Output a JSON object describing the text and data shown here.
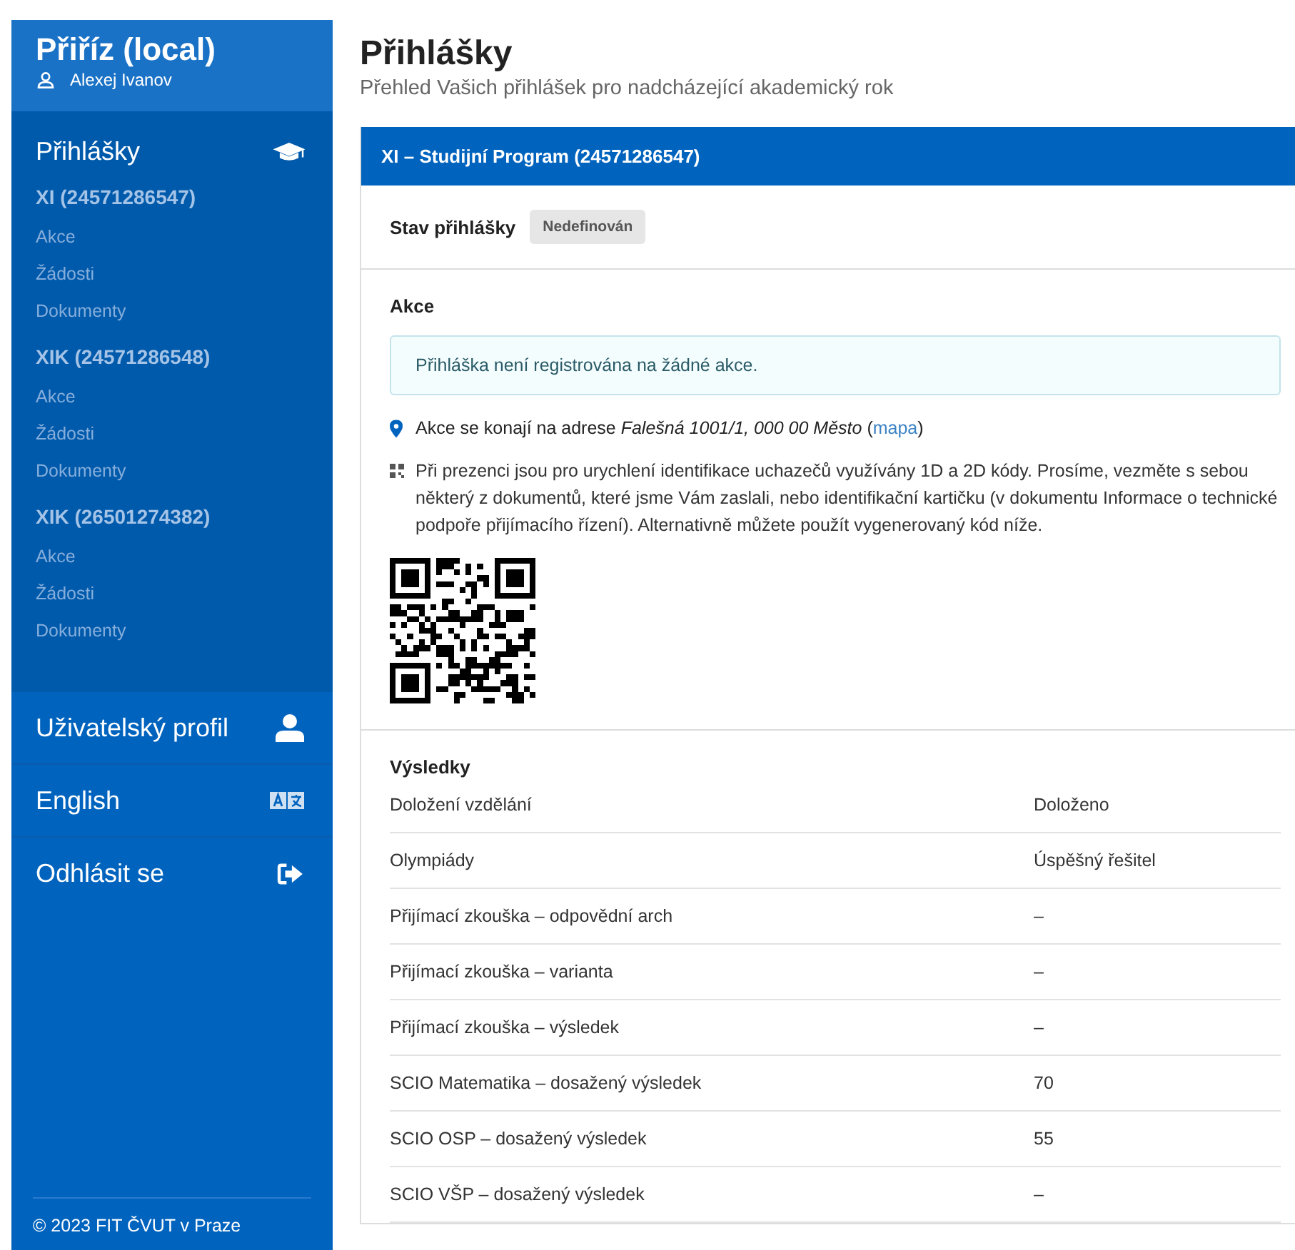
{
  "sidebar": {
    "app_title": "Přiříz (local)",
    "user": "Alexej Ivanov",
    "section": {
      "label": "Přihlášky"
    },
    "applications": [
      {
        "title": "XI (24571286547)",
        "links": [
          "Akce",
          "Žádosti",
          "Dokumenty"
        ]
      },
      {
        "title": "XIK (24571286548)",
        "links": [
          "Akce",
          "Žádosti",
          "Dokumenty"
        ]
      },
      {
        "title": "XIK (26501274382)",
        "links": [
          "Akce",
          "Žádosti",
          "Dokumenty"
        ]
      }
    ],
    "menu": [
      {
        "label": "Uživatelský profil",
        "kind": "profile"
      },
      {
        "label": "English",
        "kind": "language"
      },
      {
        "label": "Odhlásit se",
        "kind": "logout"
      }
    ],
    "footer": "© 2023 FIT ČVUT v Praze"
  },
  "page": {
    "title": "Přihlášky",
    "subtitle": "Přehled Vašich přihlášek pro nadcházející akademický rok"
  },
  "application_card": {
    "header": "XI – Studijní Program (24571286547)",
    "status_label": "Stav přihlášky",
    "status_badge": "Nedefinován",
    "events": {
      "heading": "Akce",
      "notice": "Přihláška není registrována na žádné akce.",
      "location": {
        "text": "Akce se konají na adrese *Falešná 1001/1, 000 00 Město* (",
        "link": "mapa",
        "after": ")"
      },
      "codes_info": "Při prezenci jsou pro urychlení identifikace uchazečů využívány 1D a 2D kódy. Prosíme, vezměte s sebou některý z dokumentů, které jsme Vám zaslali, nebo identifikační kartičku (v dokumentu Informace o technické podpoře přijímacího řízení). Alternativně můžete použít vygenerovaný kód níže."
    },
    "results": {
      "heading": "Výsledky",
      "rows": [
        {
          "label": "Doložení vzdělání",
          "value": "Doloženo"
        },
        {
          "label": "Olympiády",
          "value": "Úspěšný řešitel"
        },
        {
          "label": "Přijímací zkouška – odpovědní arch",
          "value": "–"
        },
        {
          "label": "Přijímací zkouška – varianta",
          "value": "–"
        },
        {
          "label": "Přijímací zkouška – výsledek",
          "value": "–"
        },
        {
          "label": "SCIO Matematika – dosažený výsledek",
          "value": "70"
        },
        {
          "label": "SCIO OSP – dosažený výsledek",
          "value": "55"
        },
        {
          "label": "SCIO VŠP – dosažený výsledek",
          "value": "–"
        }
      ]
    }
  }
}
